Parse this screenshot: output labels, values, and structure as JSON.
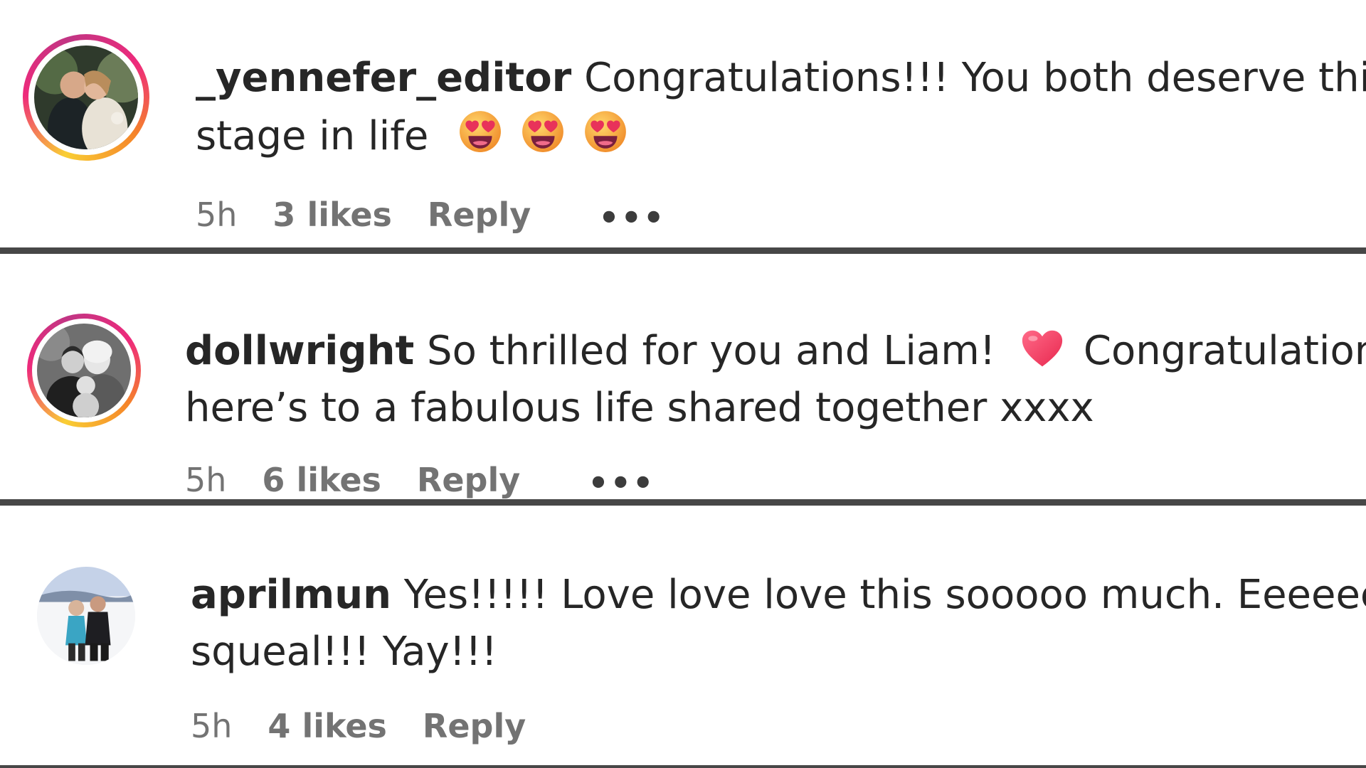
{
  "comments": [
    {
      "username": "_yennefer_editor",
      "line1": " Congratulations!!! You both deserve this",
      "line2": "stage in life",
      "time": "5h",
      "likes": "3 likes",
      "reply": "Reply",
      "more": "•••",
      "emojis": [
        "heart-eyes-emoji",
        "heart-eyes-emoji",
        "heart-eyes-emoji"
      ]
    },
    {
      "username": "dollwright",
      "line1_a": " So thrilled for you and Liam! ",
      "line1_b": " Congratulations,",
      "line2": "here’s to a fabulous life shared together xxxx",
      "time": "5h",
      "likes": "6 likes",
      "reply": "Reply",
      "more": "•••",
      "emojis": [
        "red-heart-emoji"
      ]
    },
    {
      "username": "aprilmun",
      "line1": " Yes!!!!! Love love love this sooooo much. Eeeeeekkkk",
      "line2": "squeal!!! Yay!!!",
      "time": "5h",
      "likes": "4 likes",
      "reply": "Reply"
    }
  ],
  "colors": {
    "separator": "#474747",
    "meta_text": "#737373",
    "story_ring_start": "#f9ce34",
    "story_ring_mid": "#ee2a7b",
    "story_ring_end": "#c13584"
  }
}
